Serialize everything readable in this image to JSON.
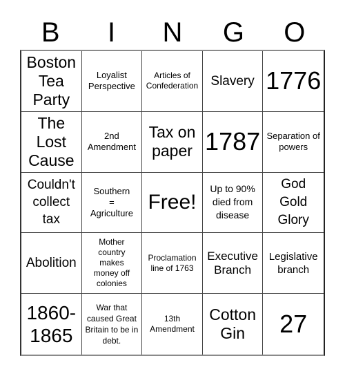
{
  "header": [
    "B",
    "I",
    "N",
    "G",
    "O"
  ],
  "cells": [
    "Boston Tea Party",
    "Loyalist Perspective",
    "Articles of Confederation",
    "Slavery",
    "1776",
    "The Lost Cause",
    "2nd Amendment",
    "Tax on paper",
    "1787",
    "Separation of powers",
    "Couldn't collect tax",
    "Southern = Agriculture",
    "Free!",
    "Up to 90% died from disease",
    "God Gold Glory",
    "Abolition",
    "Mother country makes money off colonies",
    "Proclamation line of 1763",
    "Executive Branch",
    "Legislative branch",
    "1860-1865",
    "War that caused Great Britain to be in debt.",
    "13th Amendment",
    "Cotton Gin",
    "27"
  ]
}
